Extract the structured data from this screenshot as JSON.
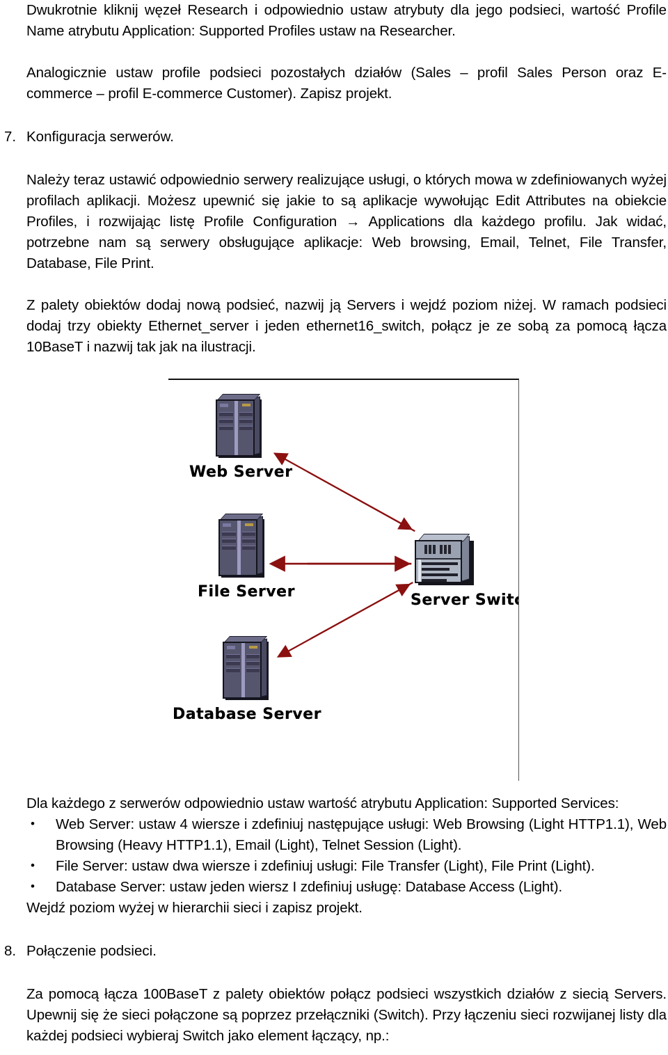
{
  "document": {
    "language": "pl",
    "paragraphs": {
      "p1": "Dwukrotnie kliknij węzeł Research i odpowiednio ustaw atrybuty dla jego podsieci, wartość Profile Name atrybutu Application: Supported Profiles ustaw na Researcher.",
      "p2": "Analogicznie ustaw profile podsieci pozostałych działów (Sales – profil Sales Person oraz E-commerce – profil E-commerce Customer). Zapisz projekt.",
      "p3": "Należy teraz ustawić odpowiednio serwery realizujące usługi, o których mowa w zdefiniowanych wyżej profilach aplikacji. Możesz upewnić się jakie to są aplikacje wywołując Edit Attributes na obiekcie Profiles, i rozwijając listę Profile Configuration → Applications dla każdego profilu. Jak widać, potrzebne nam są serwery obsługujące aplikacje: Web browsing, Email, Telnet, File Transfer, Database, File Print.",
      "p4": "Z palety obiektów dodaj nową podsieć, nazwij ją Servers i wejdź poziom niżej. W ramach podsieci dodaj trzy obiekty Ethernet_server i jeden ethernet16_switch, połącz je ze sobą za pomocą łącza 10BaseT i nazwij tak jak na ilustracji.",
      "p5": "Dla każdego z serwerów odpowiednio ustaw wartość atrybutu Application: Supported Services:",
      "p6": "Wejdź poziom wyżej w hierarchii sieci i zapisz projekt.",
      "p7": "Za pomocą łącza 100BaseT z palety obiektów połącz podsieci wszystkich działów z siecią Servers. Upewnij się że sieci połączone są poprzez przełączniki (Switch). Przy łączeniu sieci rozwijanej listy dla każdej podsieci wybieraj Switch jako element łączący, np.:"
    },
    "headings": {
      "item7_number": "7.",
      "item7_text": "Konfiguracja serwerów.",
      "item8_number": "8.",
      "item8_text": "Połączenie podsieci."
    },
    "bullets": {
      "marker": "•",
      "items": [
        "Web Server: ustaw 4 wiersze i zdefiniuj następujące usługi: Web Browsing (Light HTTP1.1), Web Browsing (Heavy HTTP1.1), Email (Light), Telnet Session (Light).",
        "File Server: ustaw dwa wiersze i zdefiniuj usługi: File Transfer (Light), File Print (Light).",
        "Database Server: ustaw jeden wiersz I zdefiniuj usługę: Database Access (Light)."
      ]
    },
    "figure": {
      "nodes": [
        {
          "id": "web-server",
          "label": "Web Server",
          "type": "server"
        },
        {
          "id": "file-server",
          "label": "File Server",
          "type": "server"
        },
        {
          "id": "database-server",
          "label": "Database Server",
          "type": "server"
        },
        {
          "id": "server-switch",
          "label": "Server Switch",
          "type": "switch"
        }
      ],
      "links": [
        {
          "from": "web-server",
          "to": "server-switch"
        },
        {
          "from": "file-server",
          "to": "server-switch"
        },
        {
          "from": "database-server",
          "to": "server-switch"
        }
      ],
      "link_color": "#8B1010",
      "link_type": "10BaseT"
    }
  }
}
